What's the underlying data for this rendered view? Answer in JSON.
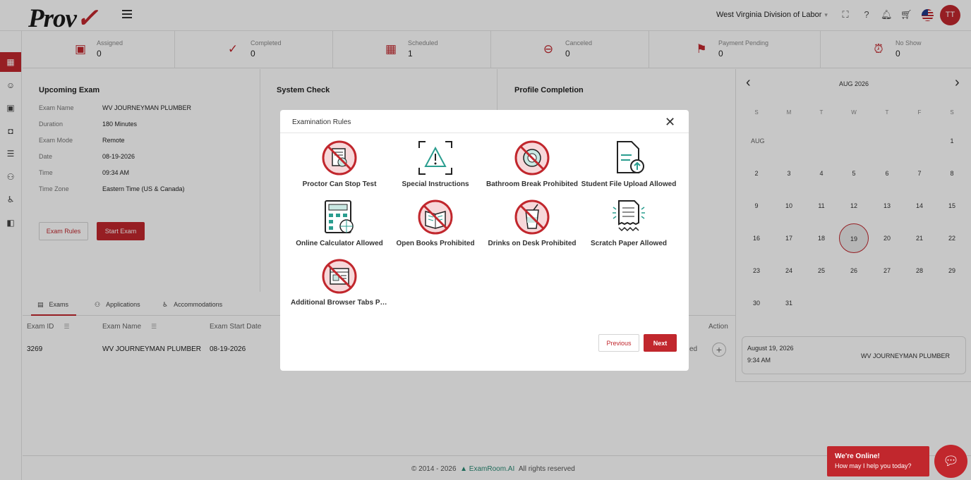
{
  "header": {
    "logo_text": "Prov",
    "organization": "West Virginia Division of Labor",
    "avatar_initials": "TT",
    "accent_color": "#c1272d"
  },
  "sidebar": {
    "items": [
      {
        "icon": "dashboard-icon"
      },
      {
        "icon": "user-remove-icon"
      },
      {
        "icon": "id-card-icon"
      },
      {
        "icon": "shield-icon"
      },
      {
        "icon": "document-icon"
      },
      {
        "icon": "users-icon"
      },
      {
        "icon": "accommodations-icon"
      },
      {
        "icon": "book-icon"
      }
    ]
  },
  "stats": [
    {
      "label": "Assigned",
      "value": "0",
      "icon": "assigned-icon"
    },
    {
      "label": "Completed",
      "value": "0",
      "icon": "check-circle-icon"
    },
    {
      "label": "Scheduled",
      "value": "1",
      "icon": "calendar-icon"
    },
    {
      "label": "Canceled",
      "value": "0",
      "icon": "minus-circle-icon"
    },
    {
      "label": "Payment Pending",
      "value": "0",
      "icon": "payment-icon"
    },
    {
      "label": "No Show",
      "value": "0",
      "icon": "alarm-off-icon"
    }
  ],
  "upcoming": {
    "title": "Upcoming Exam",
    "rows": [
      {
        "key": "Exam Name",
        "value": "WV JOURNEYMAN PLUMBER"
      },
      {
        "key": "Duration",
        "value": "180 Minutes"
      },
      {
        "key": "Exam Mode",
        "value": "Remote"
      },
      {
        "key": "Date",
        "value": "08-19-2026"
      },
      {
        "key": "Time",
        "value": "09:34 AM"
      },
      {
        "key": "Time Zone",
        "value": "Eastern Time (US & Canada)"
      }
    ],
    "rules_button": "Exam Rules",
    "start_button": "Start Exam"
  },
  "system_check": {
    "title": "System Check"
  },
  "profile": {
    "title": "Profile Completion"
  },
  "tabs": [
    "Exams",
    "Applications",
    "Accommodations"
  ],
  "table": {
    "headers": [
      "Exam ID",
      "Exam Name",
      "Exam Start Date",
      "Action"
    ],
    "row": {
      "id": "3269",
      "name": "WV JOURNEYMAN PLUMBER",
      "date": "08-19-2026",
      "status_fragment": "ed"
    }
  },
  "calendar": {
    "month": "AUG 2026",
    "month_label": "AUG",
    "weekdays": [
      "S",
      "M",
      "T",
      "W",
      "T",
      "F",
      "S"
    ],
    "selected_day": "19",
    "event": {
      "date": "August 19, 2026",
      "time": "9:34 AM",
      "name": "WV JOURNEYMAN PLUMBER"
    }
  },
  "footer": {
    "copyright": "© 2014 - 2026",
    "brand": "ExamRoom.AI",
    "rights": "All rights reserved"
  },
  "modal": {
    "title": "Examination Rules",
    "rules": [
      {
        "label": "Proctor Can Stop Test",
        "icon": "proctor-stop-icon"
      },
      {
        "label": "Special Instructions",
        "icon": "special-instructions-icon"
      },
      {
        "label": "Bathroom Break Prohibited",
        "icon": "bathroom-prohibited-icon"
      },
      {
        "label": "Student File Upload Allowed",
        "icon": "file-upload-icon"
      },
      {
        "label": "Online Calculator Allowed",
        "icon": "calculator-icon"
      },
      {
        "label": "Open Books Prohibited",
        "icon": "books-prohibited-icon"
      },
      {
        "label": "Drinks on Desk Prohibited",
        "icon": "drinks-prohibited-icon"
      },
      {
        "label": "Scratch Paper Allowed",
        "icon": "scratch-paper-icon"
      },
      {
        "label": "Additional Browser Tabs Prohibited",
        "icon": "browser-tabs-prohibited-icon"
      }
    ],
    "previous": "Previous",
    "next": "Next"
  },
  "chat": {
    "title": "We're Online!",
    "subtitle": "How may I help you today?"
  }
}
